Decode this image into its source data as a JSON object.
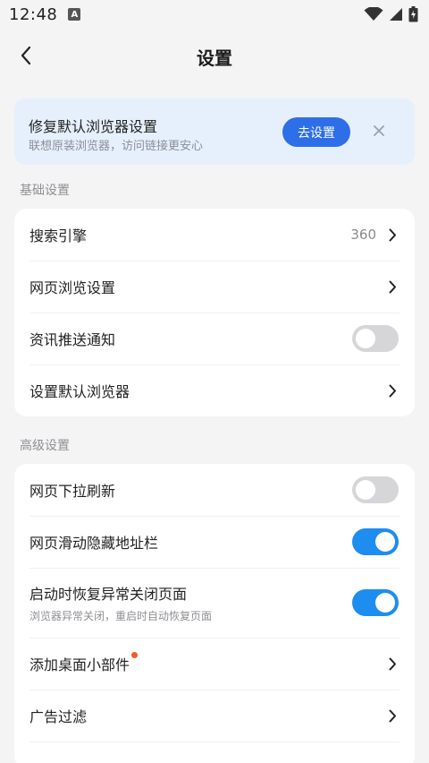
{
  "status_bar": {
    "time": "12:48",
    "notif_badge": "A"
  },
  "header": {
    "title": "设置"
  },
  "banner": {
    "title": "修复默认浏览器设置",
    "subtitle": "联想原装浏览器，访问链接更安心",
    "button_label": "去设置"
  },
  "basic": {
    "section_title": "基础设置",
    "search_engine": {
      "label": "搜索引擎",
      "value": "360"
    },
    "web_browse": {
      "label": "网页浏览设置"
    },
    "news_push": {
      "label": "资讯推送通知",
      "state": "off"
    },
    "default_browser": {
      "label": "设置默认浏览器"
    }
  },
  "advanced": {
    "section_title": "高级设置",
    "pull_refresh": {
      "label": "网页下拉刷新",
      "state": "off"
    },
    "hide_address": {
      "label": "网页滑动隐藏地址栏",
      "state": "on"
    },
    "restore_pages": {
      "label": "启动时恢复异常关闭页面",
      "sub": "浏览器异常关闭，重启时自动恢复页面",
      "state": "on"
    },
    "desktop_widget": {
      "label": "添加桌面小部件"
    },
    "ad_filter": {
      "label": "广告过滤"
    }
  },
  "colors": {
    "accent": "#2e6fe8",
    "toggle_on": "#1e8df0",
    "red_dot": "#f05a28"
  }
}
